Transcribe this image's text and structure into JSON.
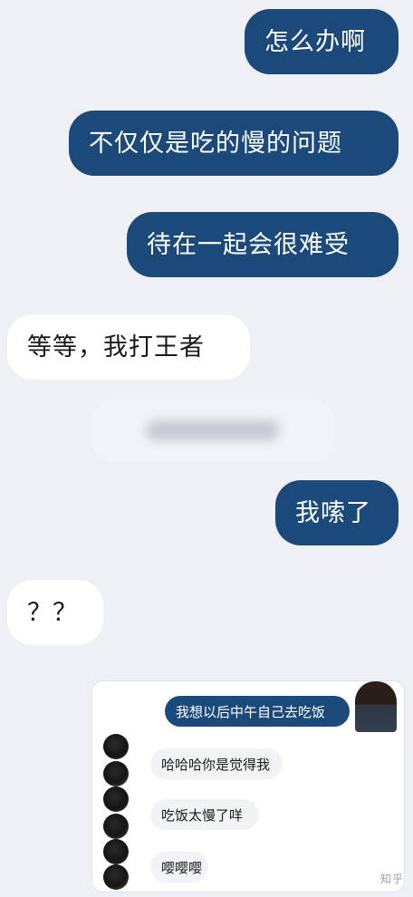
{
  "messages": [
    {
      "side": "sent",
      "text": "怎么办啊"
    },
    {
      "side": "sent",
      "text": "不仅仅是吃的慢的问题"
    },
    {
      "side": "sent",
      "text": "待在一起会很难受"
    },
    {
      "side": "received",
      "text": "等等，我打王者"
    },
    {
      "side": "sent",
      "text": "我嗦了"
    },
    {
      "side": "received",
      "text": "？？"
    }
  ],
  "inset": {
    "sent": "我想以后中午自己去吃饭",
    "received": [
      "哈哈哈你是觉得我",
      "吃饭太慢了咩",
      "嘤嘤嘤"
    ]
  },
  "watermark": "知乎"
}
